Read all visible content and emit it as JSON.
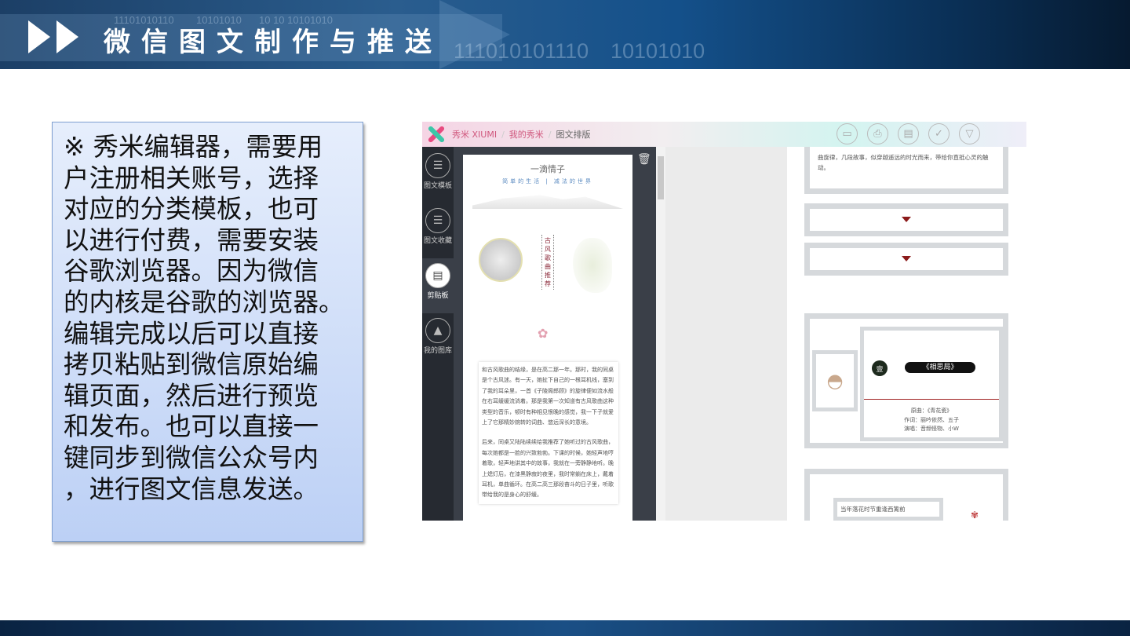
{
  "header": {
    "title": "微信图文制作与推送",
    "binary": [
      "11101010110",
      "10101010",
      "10 10 10101010",
      "111010101110",
      "10101010"
    ]
  },
  "textbox": {
    "lines": [
      "※ 秀米编辑器，需要用",
      "户注册相关账号，选择",
      "对应的分类模板，也可",
      "以进行付费，需要安装",
      "谷歌浏览器。因为微信",
      "的内核是谷歌的浏览器。",
      "编辑完成以后可以直接",
      "拷贝粘贴到微信原始编",
      "辑页面，然后进行预览",
      "和发布。也可以直接一",
      "键同步到微信公众号内",
      "，进行图文信息发送。"
    ]
  },
  "app": {
    "breadcrumb": [
      "秀米 XIUMI",
      "我的秀米",
      "图文排版"
    ],
    "toolbar_icons": [
      "folder-icon",
      "print-preview-icon",
      "copy-icon",
      "check-icon",
      "dropdown-icon"
    ],
    "sidebar": [
      {
        "label": "图文模板",
        "icon": "list-icon"
      },
      {
        "label": "图文收藏",
        "icon": "favorite-icon"
      },
      {
        "label": "剪贴板",
        "icon": "clipboard-icon"
      },
      {
        "label": "我的图库",
        "icon": "gallery-icon"
      }
    ],
    "preview": {
      "title": "一滴情子",
      "subtitle": "简单的生活 | 减法的世界",
      "vertical": "古风歌曲推荐",
      "para1": "和古风歌曲的结缘，是在高二那一年。那时，我的同桌是个古风迷。有一天，她扯下自己的一根耳机线，塞到了我的耳朵里，一首《子陵阁郎顾》的旋律便如流水般在右耳缓缓流淌着。那是我第一次知道有古风歌曲这种类型的音乐，顿时有种相见恨晚的感觉，我一下子就爱上了它那精妙婉转的词曲、悠远深长的意境。",
      "para2": "后来，同桌又陆陆续续给我推荐了她听过的古风歌曲，每次她都是一脸的兴致勃勃。下课的时候，她轻声地哼着歌，轻声地讲其中的故事，我就在一旁静静地听。晚上熄灯后，在漆黑静寂的夜里，我时常躺在床上，戴着耳机，单曲循环。在高二高三那段奋斗的日子里，听歌带给我的是身心的舒缓。"
    },
    "templates": {
      "text1": "曲旋律，几段故事，似穿越遥远的时光而来，带给你直抵心灵的触动。",
      "badge": "壹",
      "song": "《相思局》",
      "credits": [
        "原曲：《青花瓷》",
        "作词：丽吟依然、五子",
        "演唱：音频怪物、小W"
      ],
      "text2": "当年落花时节重逢西篱前"
    }
  }
}
